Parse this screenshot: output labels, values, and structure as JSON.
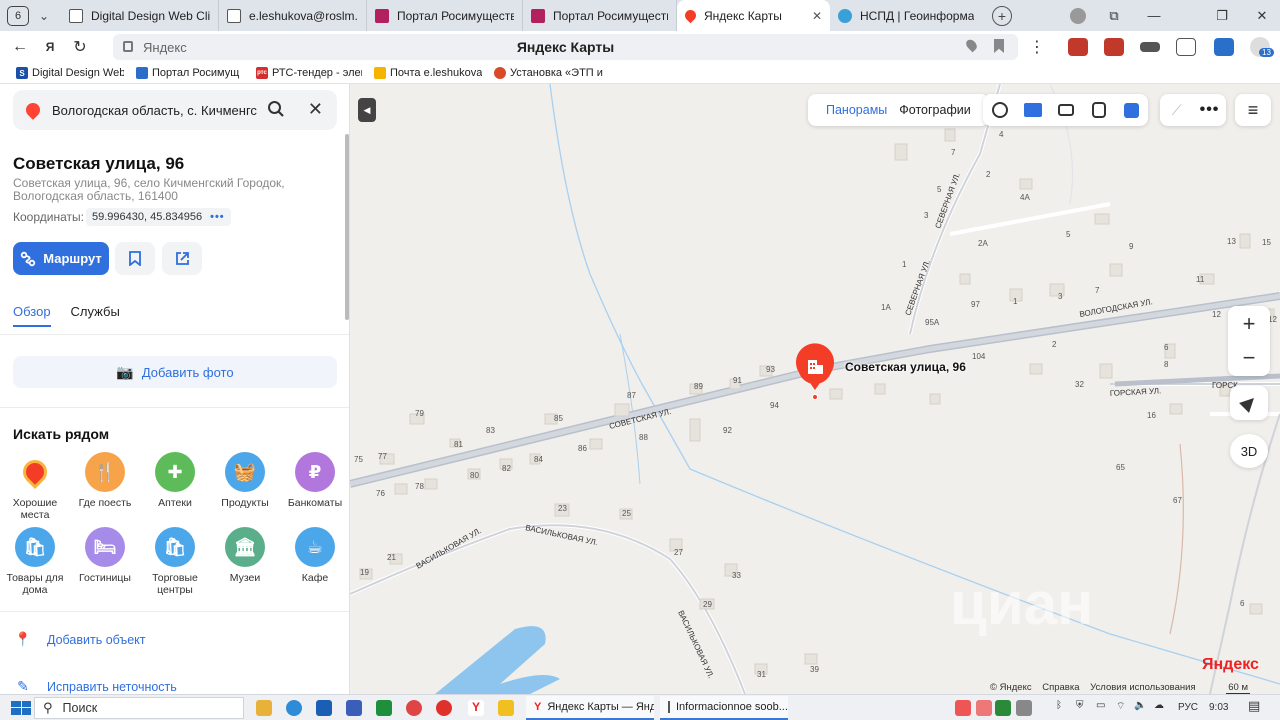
{
  "browser": {
    "tab_count": "6",
    "tabs": [
      {
        "label": "Digital Design Web Clie",
        "color": "#2a6fc9"
      },
      {
        "label": "e.leshukova@roslm.gov",
        "color": "#888888"
      },
      {
        "label": "Портал Росимущества",
        "color": "#b2205d"
      },
      {
        "label": "Портал Росимущества",
        "color": "#b2205d"
      },
      {
        "label": "Яндекс Карты",
        "color": "#f43d27",
        "active": true
      },
      {
        "label": "НСПД | Геоинформаци",
        "color": "#3aa0d8"
      }
    ],
    "address_host": "Яндекс",
    "page_title": "Яндекс Карты",
    "badge": "13",
    "bookmarks": [
      {
        "label": "Digital Design Web",
        "color": "#1b4fa8",
        "glyph": "S"
      },
      {
        "label": "Портал Росимущ",
        "color": "#2b6dc9",
        "glyph": ""
      },
      {
        "label": "РТС-тендер - элек",
        "color": "#d32f2f",
        "glyph": "ртс"
      },
      {
        "label": "Почта e.leshukova",
        "color": "#f5b400",
        "glyph": ""
      },
      {
        "label": "Установка «ЭТП и",
        "color": "#d94a2a",
        "glyph": ""
      }
    ]
  },
  "panel": {
    "search_value": "Вологодская область, с. Кичменгский",
    "title": "Советская улица, 96",
    "full_address": "Советская улица, 96, село Кичменгский Городок, Вологодская область, 161400",
    "coords_label": "Координаты:",
    "coords_value": "59.996430, 45.834956",
    "route_label": "Маршрут",
    "tabs": [
      "Обзор",
      "Службы"
    ],
    "add_photo": "Добавить фото",
    "nearby_title": "Искать рядом",
    "categories": [
      {
        "label": "Хорошие места",
        "color": "#ffffff",
        "icon": "good-places-icon"
      },
      {
        "label": "Где поесть",
        "color": "#f6a34a",
        "icon": "fork-knife-icon"
      },
      {
        "label": "Аптеки",
        "color": "#5dbb5a",
        "icon": "pharmacy-cross-icon"
      },
      {
        "label": "Продукты",
        "color": "#4ca6ea",
        "icon": "basket-icon"
      },
      {
        "label": "Банкоматы",
        "color": "#b277dd",
        "icon": "ruble-icon"
      },
      {
        "label": "Товары для дома",
        "color": "#4ca6ea",
        "icon": "shopping-bag-icon"
      },
      {
        "label": "Гостиницы",
        "color": "#a78be8",
        "icon": "bed-icon"
      },
      {
        "label": "Торговые центры",
        "color": "#4ca6ea",
        "icon": "shopping-bag-icon"
      },
      {
        "label": "Музеи",
        "color": "#5aae8a",
        "icon": "museum-icon"
      },
      {
        "label": "Кафе",
        "color": "#4ca6ea",
        "icon": "cup-icon"
      }
    ],
    "add_object": "Добавить объект",
    "fix_error": "Исправить неточность"
  },
  "map": {
    "controls": {
      "panoramas": "Панорамы",
      "photos": "Фотографии",
      "zoom_in": "+",
      "zoom_out": "−",
      "three_d": "3D"
    },
    "marker_label": "Советская улица, 96",
    "streets": {
      "sovetskaya": "СОВЕТСКАЯ УЛ.",
      "vologodskaya": "ВОЛОГОДСКАЯ УЛ.",
      "severnaya": "СЕВЕРНАЯ УЛ.",
      "severnaya2": "СЕВЕРНАЯ УЛ.",
      "gorskaya": "ГОРСКАЯ УЛ.",
      "gorskaya2": "ГОРСК",
      "vasilkovaya": "ВАСИЛЬКОВАЯ УЛ.",
      "vasilkovaya2": "ВАСИЛЬКОВАЯ УЛ.",
      "vasilkovaya3": "ВАСИЛЬКОВАЯ УЛ."
    },
    "house_numbers": {
      "h1": "79",
      "h2": "83",
      "h3": "81",
      "h4": "77",
      "h5": "75",
      "h6": "85",
      "h7": "87",
      "h8": "89",
      "h9": "91",
      "h10": "93",
      "h11": "94",
      "h12": "92",
      "h13": "88",
      "h14": "86",
      "h15": "84",
      "h16": "82",
      "h17": "80",
      "h18": "78",
      "h19": "76",
      "h20": "23",
      "h21": "25",
      "h22": "27",
      "h23": "33",
      "h24": "29",
      "h25": "31",
      "h26": "39",
      "h27": "21",
      "h28": "19",
      "h29": "104",
      "h30": "2",
      "h31": "32",
      "h32": "16",
      "h33": "65",
      "h34": "67",
      "h35": "6",
      "h36": "6",
      "h37": "8",
      "h38": "12",
      "h39": "12",
      "h40": "11",
      "h41": "9",
      "h42": "13",
      "h43": "15",
      "h44": "5",
      "h45": "4A",
      "h46": "2",
      "h47": "4",
      "h48": "7",
      "h49": "5",
      "h50": "3",
      "h51": "2A",
      "h52": "1",
      "h53": "97",
      "h54": "1",
      "h55": "3",
      "h56": "7",
      "h57": "1A",
      "h58": "95A"
    },
    "copyright": "© Яндекс",
    "help": "Справка",
    "terms": "Условия использования",
    "scale": "60 м",
    "logo": "Яндекс",
    "watermark": "циан"
  },
  "taskbar": {
    "search": "Поиск",
    "apps": [
      "Яндекс Карты — Янд...",
      "Informacionnoe soob..."
    ],
    "lang": "РУС",
    "time": "9:03"
  }
}
